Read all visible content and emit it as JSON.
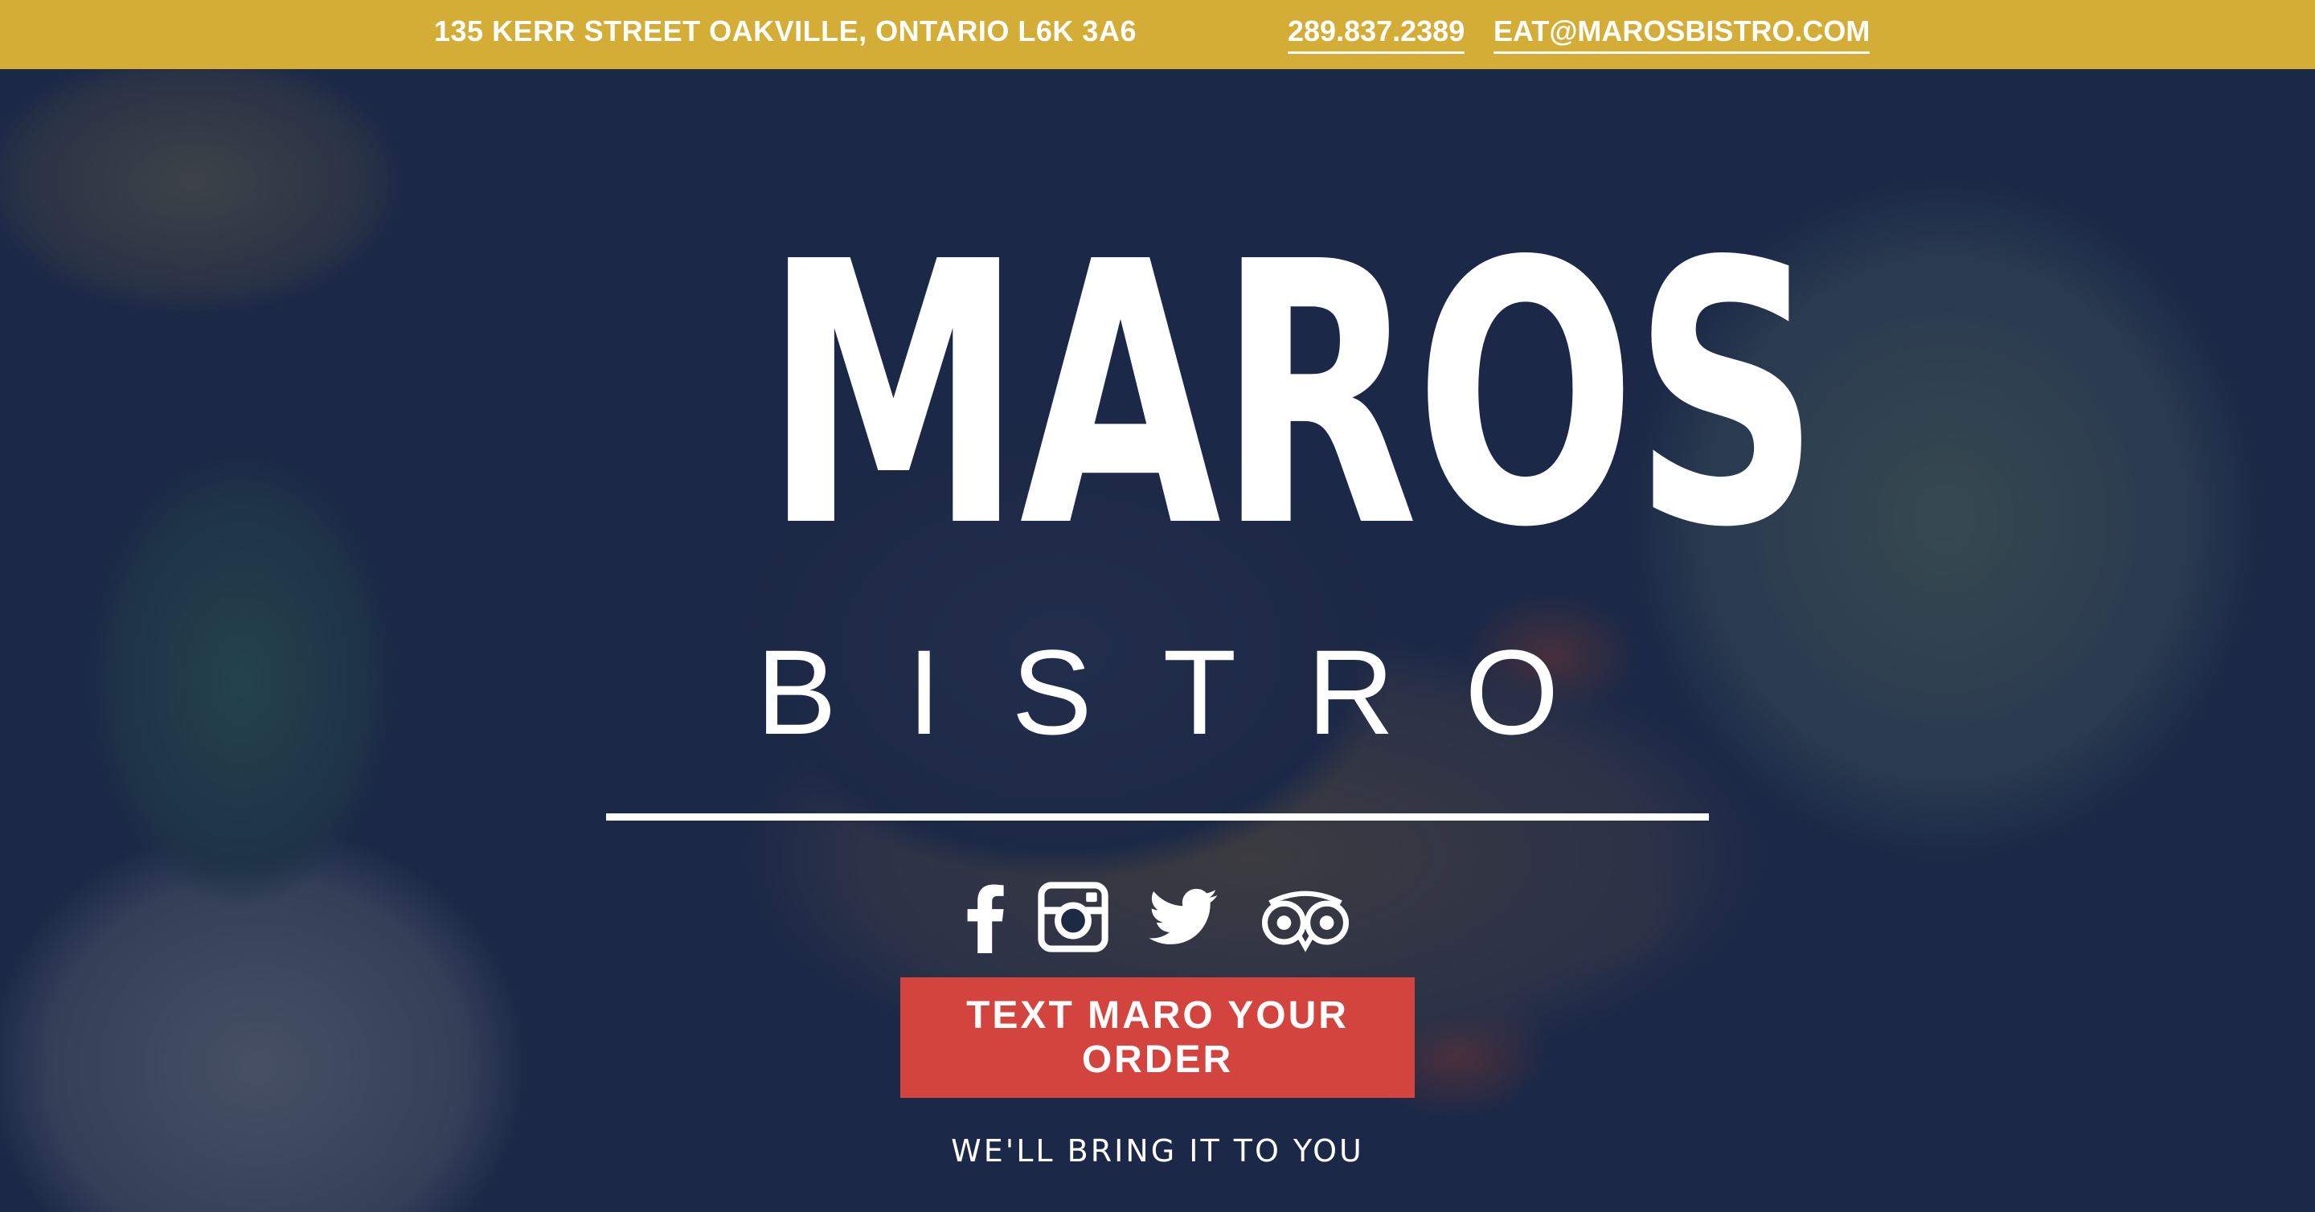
{
  "topbar": {
    "address": "135 KERR STREET OAKVILLE, ONTARIO L6K 3A6",
    "phone": "289.837.2389",
    "email": "EAT@MAROSBISTRO.COM",
    "background_color": "#d4ad36"
  },
  "logo": {
    "line1": "MAROS",
    "line2": "BISTRO"
  },
  "social": [
    {
      "name": "facebook-icon"
    },
    {
      "name": "instagram-icon"
    },
    {
      "name": "twitter-icon"
    },
    {
      "name": "tripadvisor-icon"
    }
  ],
  "cta": {
    "label": "TEXT MARO YOUR ORDER",
    "color": "#d3443f"
  },
  "tagline": "WE'LL BRING IT TO YOU"
}
